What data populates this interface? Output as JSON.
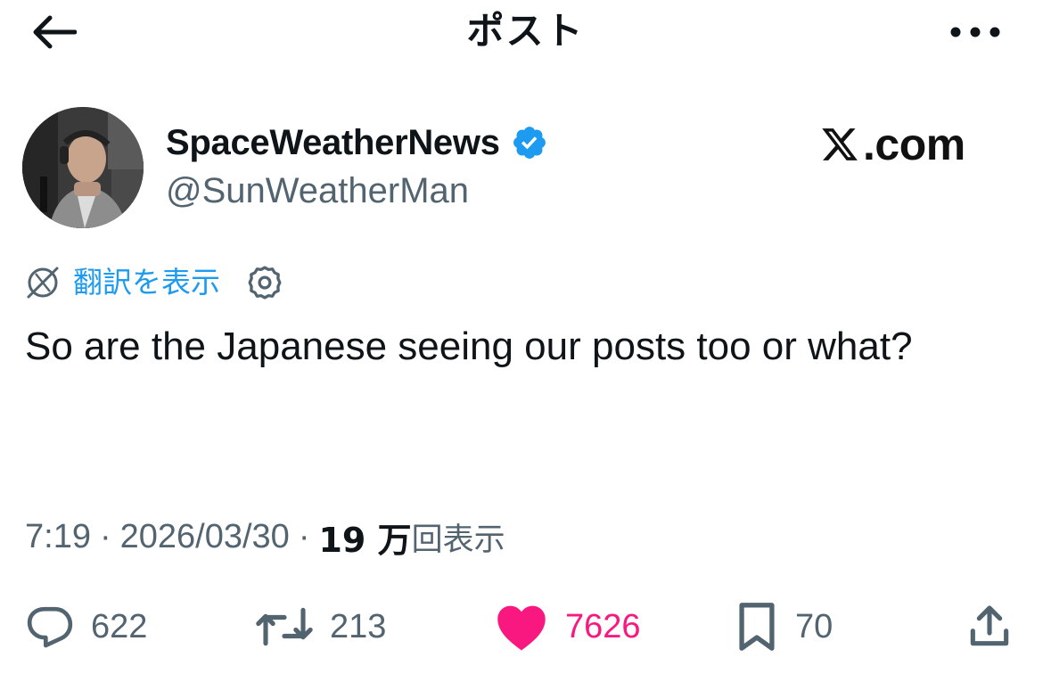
{
  "header": {
    "title": "ポスト",
    "back_icon": "arrow-left-icon",
    "more_icon": "more-horizontal-icon"
  },
  "author": {
    "display_name": "SpaceWeatherNews",
    "handle": "@SunWeatherMan",
    "verified": true,
    "verified_color": "#1d9bf0"
  },
  "watermark": {
    "text": ".com",
    "logo": "x-logo"
  },
  "translate": {
    "label": "翻訳を表示",
    "color": "#1d9bf0"
  },
  "tweet": {
    "text": "So are the Japanese seeing our posts too or what?"
  },
  "meta": {
    "time": "7:19",
    "separator": "·",
    "date": "2026/03/30",
    "views_count": "19 万",
    "views_label": "回表示"
  },
  "actions": {
    "replies": "622",
    "reposts": "213",
    "likes": "7626",
    "bookmarks": "70",
    "like_color": "#f91880",
    "muted_color": "#536471"
  }
}
